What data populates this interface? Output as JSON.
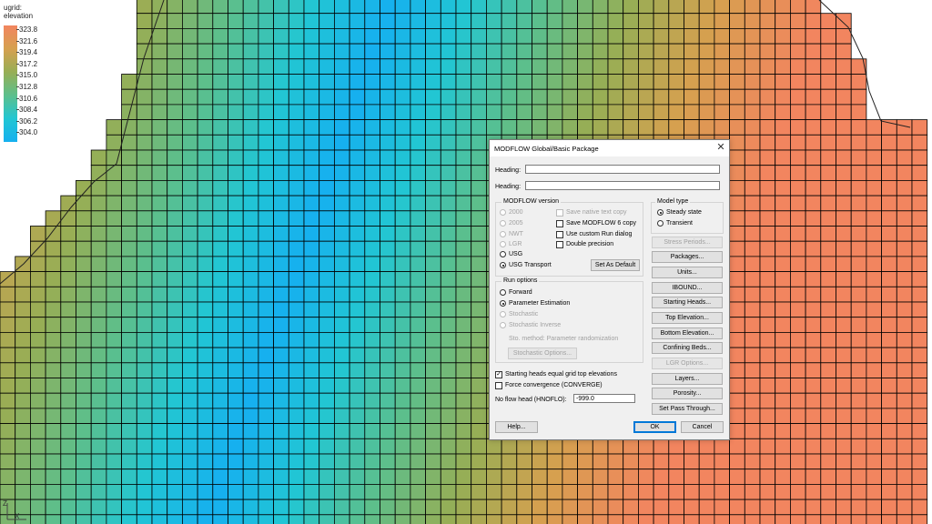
{
  "legend": {
    "title_line1": "ugrid:",
    "title_line2": "elevation",
    "ticks": [
      "323.8",
      "321.6",
      "319.4",
      "317.2",
      "315.0",
      "312.8",
      "310.6",
      "308.4",
      "306.2",
      "304.0"
    ],
    "colors": [
      "#f2855f",
      "#d6a04f",
      "#97ae55",
      "#5cbf8c",
      "#22c6d3",
      "#16b0ef"
    ]
  },
  "axes_icon": {
    "z": "Z",
    "x": "X"
  },
  "grid": {
    "cell_line_color": "#000000",
    "min_value": 304.0,
    "max_value": 323.8
  },
  "dialog": {
    "title": "MODFLOW Global/Basic Package",
    "close_symbol": "✕",
    "heading1_label": "Heading:",
    "heading1_value": "",
    "heading2_label": "Heading:",
    "heading2_value": "",
    "version_group": "MODFLOW version",
    "versions": [
      "2000",
      "2005",
      "NWT",
      "LGR",
      "USG",
      "USG Transport"
    ],
    "selected_version": "USG Transport",
    "save_native": "Save native text copy",
    "save_mf6": "Save MODFLOW 6 copy",
    "custom_run": "Use custom Run dialog",
    "double_precision": "Double precision",
    "set_default": "Set As Default",
    "run_group": "Run options",
    "run_options": [
      "Forward",
      "Parameter Estimation",
      "Stochastic",
      "Stochastic Inverse"
    ],
    "selected_run": "Parameter Estimation",
    "sto_method": "Sto. method: Parameter randomization",
    "stochastic_options": "Stochastic Options...",
    "starting_heads_chk": "Starting heads equal grid top elevations",
    "starting_heads_checked": true,
    "force_convergence": "Force convergence (CONVERGE)",
    "hnoflo_label": "No flow head (HNOFLO):",
    "hnoflo_value": "-999.0",
    "model_type_group": "Model type",
    "model_types": [
      "Steady state",
      "Transient"
    ],
    "selected_model_type": "Steady state",
    "side_buttons": [
      "Stress Periods...",
      "Packages...",
      "Units...",
      "IBOUND...",
      "Starting Heads...",
      "Top Elevation...",
      "Bottom Elevation...",
      "Confining Beds...",
      "LGR Options...",
      "Layers...",
      "Porosity...",
      "Set Pass Through..."
    ],
    "help": "Help...",
    "ok": "OK",
    "cancel": "Cancel"
  }
}
